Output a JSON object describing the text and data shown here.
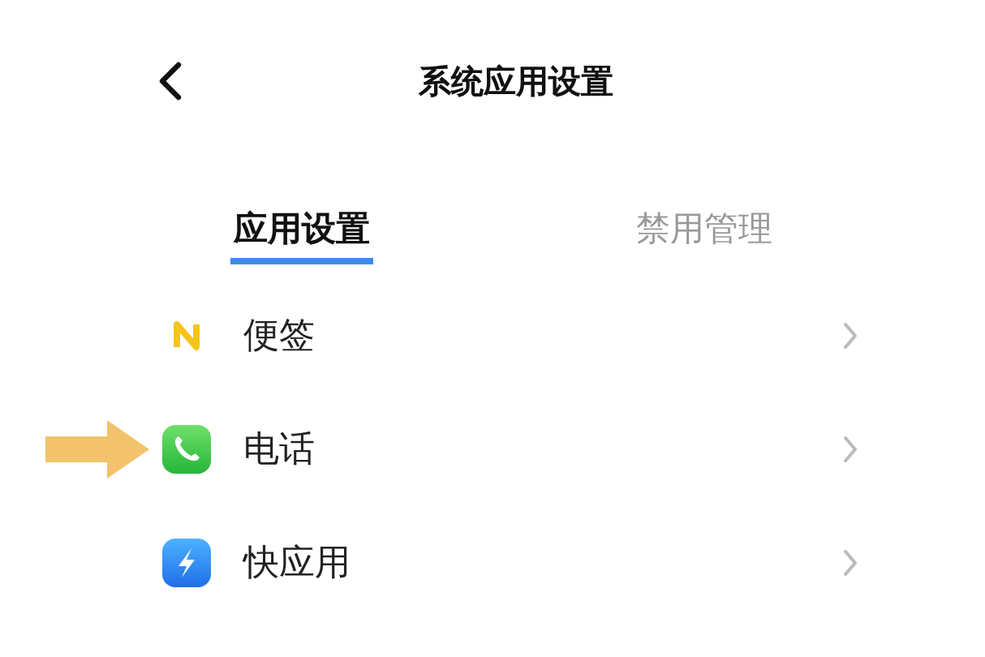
{
  "header": {
    "title": "系统应用设置"
  },
  "tabs": [
    {
      "label": "应用设置",
      "selected": true
    },
    {
      "label": "禁用管理",
      "selected": false
    }
  ],
  "apps": [
    {
      "name": "便签",
      "kind": "notes",
      "pointed": false
    },
    {
      "name": "电话",
      "kind": "phone",
      "pointed": true
    },
    {
      "name": "快应用",
      "kind": "quickapp",
      "pointed": false
    }
  ]
}
